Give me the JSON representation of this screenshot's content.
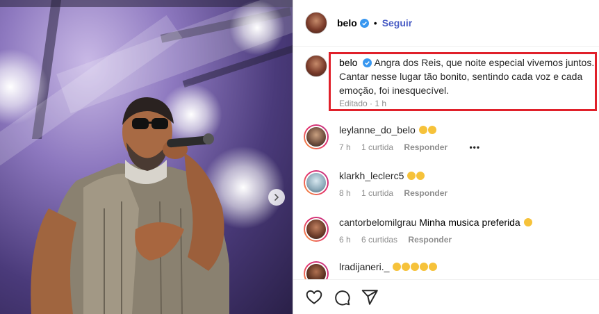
{
  "post": {
    "author": "belo",
    "follow_label": "Seguir",
    "dot": "•"
  },
  "caption": {
    "username": "belo",
    "text": "Angra dos Reis, que noite especial vivemos juntos. Cantar nesse lugar tão bonito, sentindo cada voz e cada emoção, foi inesquecível.",
    "edited_label": "Editado · 1 h"
  },
  "comments": [
    {
      "username": "leylanne_do_belo",
      "text": "",
      "time": "7 h",
      "likes": "1 curtida",
      "reply": "Responder",
      "more": "•••"
    },
    {
      "username": "klarkh_leclerc5",
      "text": "",
      "time": "8 h",
      "likes": "1 curtida",
      "reply": "Responder"
    },
    {
      "username": "cantorbelomilgrau",
      "text": "Minha musica preferida",
      "time": "6 h",
      "likes": "6 curtidas",
      "reply": "Responder"
    },
    {
      "username": "lradijaneri._",
      "text": "",
      "time": "",
      "likes": "",
      "reply": ""
    }
  ],
  "colors": {
    "accent": "#4a5dc5",
    "highlight_border": "#e0202a",
    "verified": "#3897f0"
  },
  "icons": [
    "heart-icon",
    "comment-icon",
    "share-icon",
    "verified-icon",
    "chevron-right-icon",
    "more-options-icon"
  ]
}
